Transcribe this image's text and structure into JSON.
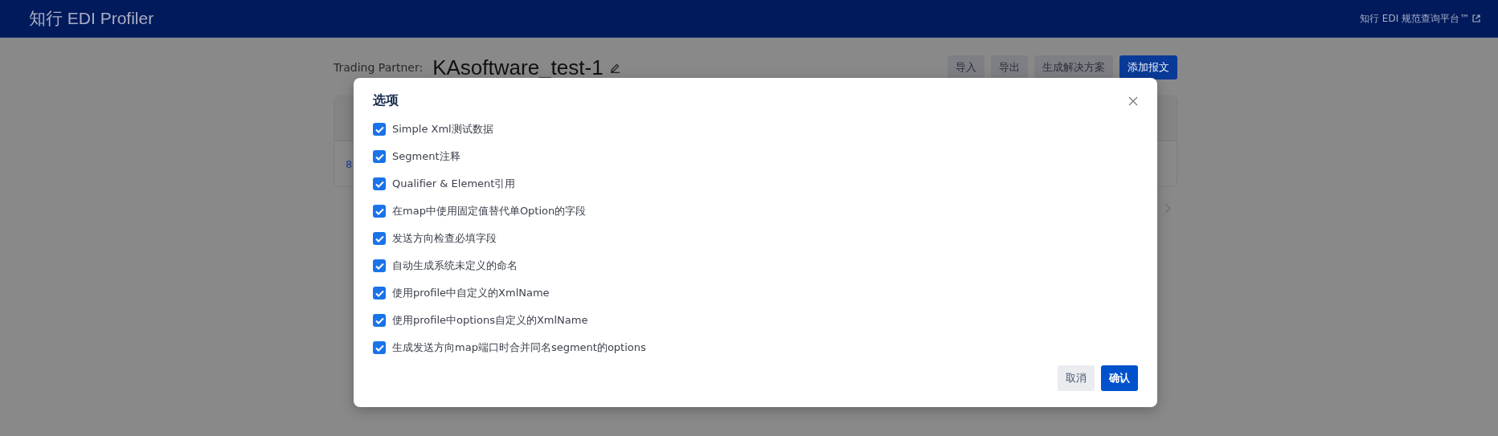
{
  "header": {
    "title": "知行 EDI Profiler",
    "link": "知行 EDI 规范查询平台™"
  },
  "page": {
    "partner_label": "Trading Partner:",
    "partner_name": "KAsoftware_test-1",
    "buttons": [
      {
        "label": "导入",
        "kind": "secondary"
      },
      {
        "label": "导出",
        "kind": "secondary"
      },
      {
        "label": "生成解决方案",
        "kind": "secondary"
      },
      {
        "label": "添加报文",
        "kind": "primary"
      }
    ],
    "table": {
      "rows": [
        {
          "cell": "8"
        }
      ]
    }
  },
  "dialog": {
    "title": "选项",
    "options": [
      {
        "label": "Simple Xml测试数据",
        "checked": true
      },
      {
        "label": "Segment注释",
        "checked": true
      },
      {
        "label": "Qualifier & Element引用",
        "checked": true
      },
      {
        "label": "在map中使用固定值替代单Option的字段",
        "checked": true
      },
      {
        "label": "发送方向检查必填字段",
        "checked": true
      },
      {
        "label": "自动生成系统未定义的命名",
        "checked": true
      },
      {
        "label": "使用profile中自定义的XmlName",
        "checked": true
      },
      {
        "label": "使用profile中options自定义的XmlName",
        "checked": true
      },
      {
        "label": "生成发送方向map端口时合并同名segment的options",
        "checked": true
      }
    ],
    "buttons": [
      {
        "label": "取消",
        "kind": "secondary"
      },
      {
        "label": "确认",
        "kind": "primary"
      }
    ]
  }
}
